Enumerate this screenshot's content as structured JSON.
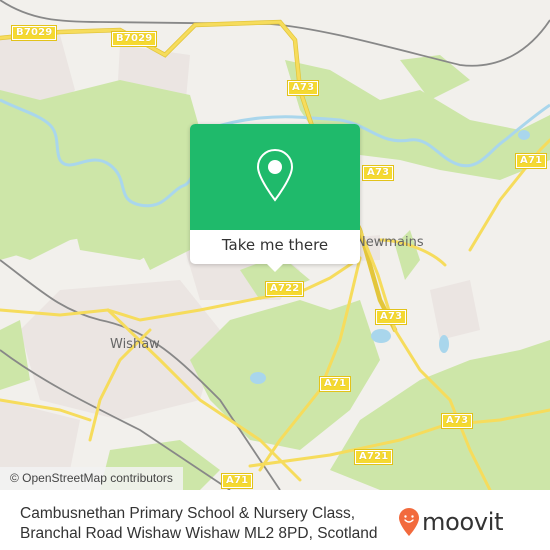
{
  "map": {
    "attribution": "© OpenStreetMap contributors",
    "road_labels": [
      {
        "id": "b7029-west",
        "text": "B7029"
      },
      {
        "id": "b7029-east",
        "text": "B7029"
      },
      {
        "id": "a73-north",
        "text": "A73"
      },
      {
        "id": "a73-mid",
        "text": "A73"
      },
      {
        "id": "a71-northeast",
        "text": "A71"
      },
      {
        "id": "a722",
        "text": "A722"
      },
      {
        "id": "a73-south",
        "text": "A73"
      },
      {
        "id": "a71-south",
        "text": "A71"
      },
      {
        "id": "a73-southeast",
        "text": "A73"
      },
      {
        "id": "a721",
        "text": "A721"
      },
      {
        "id": "a71-bottom",
        "text": "A71"
      }
    ],
    "place_labels": {
      "newmains": "Newmains",
      "wishaw": "Wishaw"
    },
    "colors": {
      "land": "#f2f0ec",
      "woodland": "#cde6a8",
      "water": "#a9d6ec",
      "road": "#f6dc5c",
      "railway": "#777777",
      "urban": "#ebe5e2"
    }
  },
  "popup": {
    "button_label": "Take me there",
    "accent_color": "#1fba6b",
    "icon": "map-pin-icon"
  },
  "footer": {
    "address_line1": "Cambusnethan Primary School & Nursery Class,",
    "address_line2": "Branchal Road Wishaw Wishaw ML2 8PD, Scotland",
    "brand": "moovit",
    "brand_color": "#f26a3d"
  }
}
